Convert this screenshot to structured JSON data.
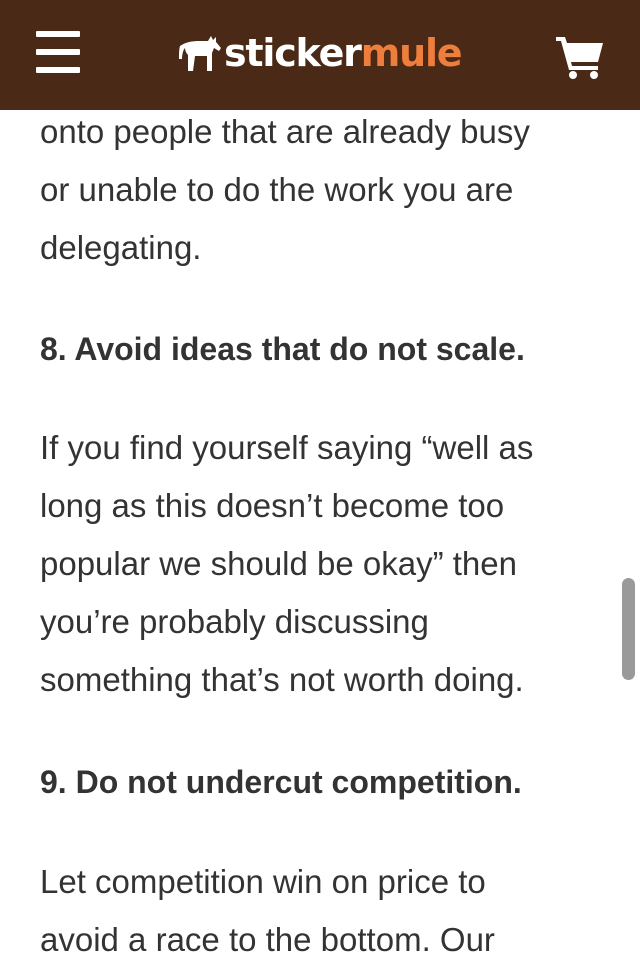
{
  "header": {
    "logo": {
      "part1": "sticker",
      "part2": "mule"
    },
    "menu_icon": "hamburger-menu-icon",
    "cart_icon": "shopping-cart-icon",
    "colors": {
      "bar": "#4a2a17",
      "logo_primary": "#ffffff",
      "logo_accent": "#ef7e3c"
    }
  },
  "article": {
    "para_top": [
      "onto people that are already busy",
      "or unable to do the work you are",
      "delegating."
    ],
    "heading_8": "8. Avoid ideas that do not scale.",
    "para_8": [
      "If you find yourself saying “well as",
      "long as this doesn’t become too",
      "popular we should be okay” then",
      "you’re probably discussing",
      "something that’s not worth doing."
    ],
    "heading_9": "9. Do not undercut competition.",
    "para_9": [
      "Let competition win on price to",
      "avoid a race to the bottom. Our"
    ]
  }
}
